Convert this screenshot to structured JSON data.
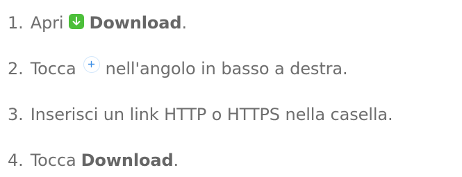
{
  "steps": [
    {
      "number": "1.",
      "text_before": "Apri",
      "icon": "green-download-arrow-icon",
      "bold": "Download",
      "text_after": "."
    },
    {
      "number": "2.",
      "text_before": "Tocca",
      "icon": "blue-plus-circle-icon",
      "text_after": "nell'angolo in basso a destra."
    },
    {
      "number": "3.",
      "text": "Inserisci un link HTTP o HTTPS nella casella."
    },
    {
      "number": "4.",
      "text_before": "Tocca",
      "bold": "Download",
      "text_after": "."
    }
  ],
  "colors": {
    "text": "#6e6e6e",
    "download_icon_bg": "#4cbf3a",
    "plus_icon": "#3d8fe6"
  }
}
